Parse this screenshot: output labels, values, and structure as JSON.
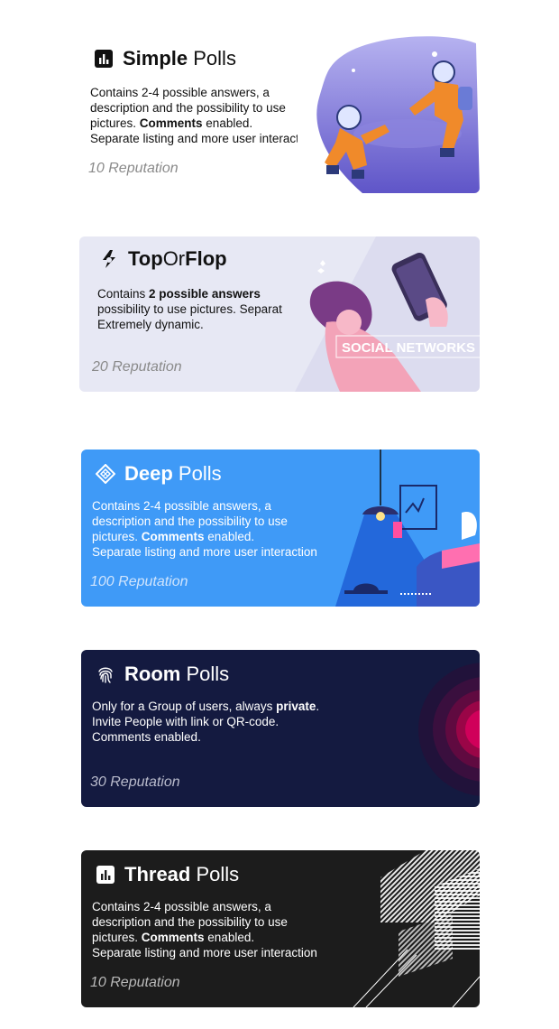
{
  "cards": [
    {
      "title_bold": "Simple",
      "title_rest": " Polls",
      "icon": "bar-chart-icon",
      "desc_line1": "Contains 2-4 possible answers, a",
      "desc_line2": "description and the possibility to use",
      "desc_line3_a": "pictures. ",
      "desc_line3_b": "Comments",
      "desc_line3_c": " enabled.",
      "desc_line4": "Separate listing and more user interaction",
      "reputation": "10 Reputation",
      "art": "astronauts-illustration"
    },
    {
      "title_bold": "Top",
      "title_mid": "Or",
      "title_bold2": "Flop",
      "icon": "lightning-flame-icon",
      "desc_line1_a": "Contains ",
      "desc_line1_b": "2 possible answers",
      "desc_line2": "possibility to use pictures. Separate",
      "desc_line3": "Extremely dynamic.",
      "reputation": "20 Reputation",
      "art": "woman-phone-illustration",
      "art_text": "SOCIAL NETWORKS"
    },
    {
      "title_bold": "Deep",
      "title_rest": " Polls",
      "icon": "diamond-grid-icon",
      "desc_line1": "Contains 2-4 possible answers, a",
      "desc_line2": "description and the possibility to use",
      "desc_line3_a": "pictures. ",
      "desc_line3_b": "Comments",
      "desc_line3_c": " enabled.",
      "desc_line4": "Separate listing and more user interaction",
      "reputation": "100 Reputation",
      "art": "lamp-desk-illustration"
    },
    {
      "title_bold": "Room",
      "title_rest": " Polls",
      "icon": "fingerprint-icon",
      "desc_line1_a": "Only for a Group of users, always ",
      "desc_line1_b": "private",
      "desc_line1_c": ".",
      "desc_line2": "Invite People with link or QR-code.",
      "desc_line3": "Comments enabled.",
      "reputation": "30 Reputation",
      "art": "concentric-circles-illustration"
    },
    {
      "title_bold": "Thread",
      "title_rest": " Polls",
      "icon": "bar-chart-icon",
      "desc_line1": "Contains 2-4 possible answers, a",
      "desc_line2": "description and the possibility to use",
      "desc_line3_a": "pictures. ",
      "desc_line3_b": "Comments",
      "desc_line3_c": " enabled.",
      "desc_line4": "Separate listing and more user interaction",
      "reputation": "10 Reputation",
      "art": "striped-cubes-illustration"
    }
  ],
  "colors": {
    "card2_bg": "#e7e8f4",
    "card3_bg": "#3f9af7",
    "card4_bg": "#141a40",
    "card5_bg": "#1c1c1c",
    "accent_pink": "#d0005a"
  }
}
